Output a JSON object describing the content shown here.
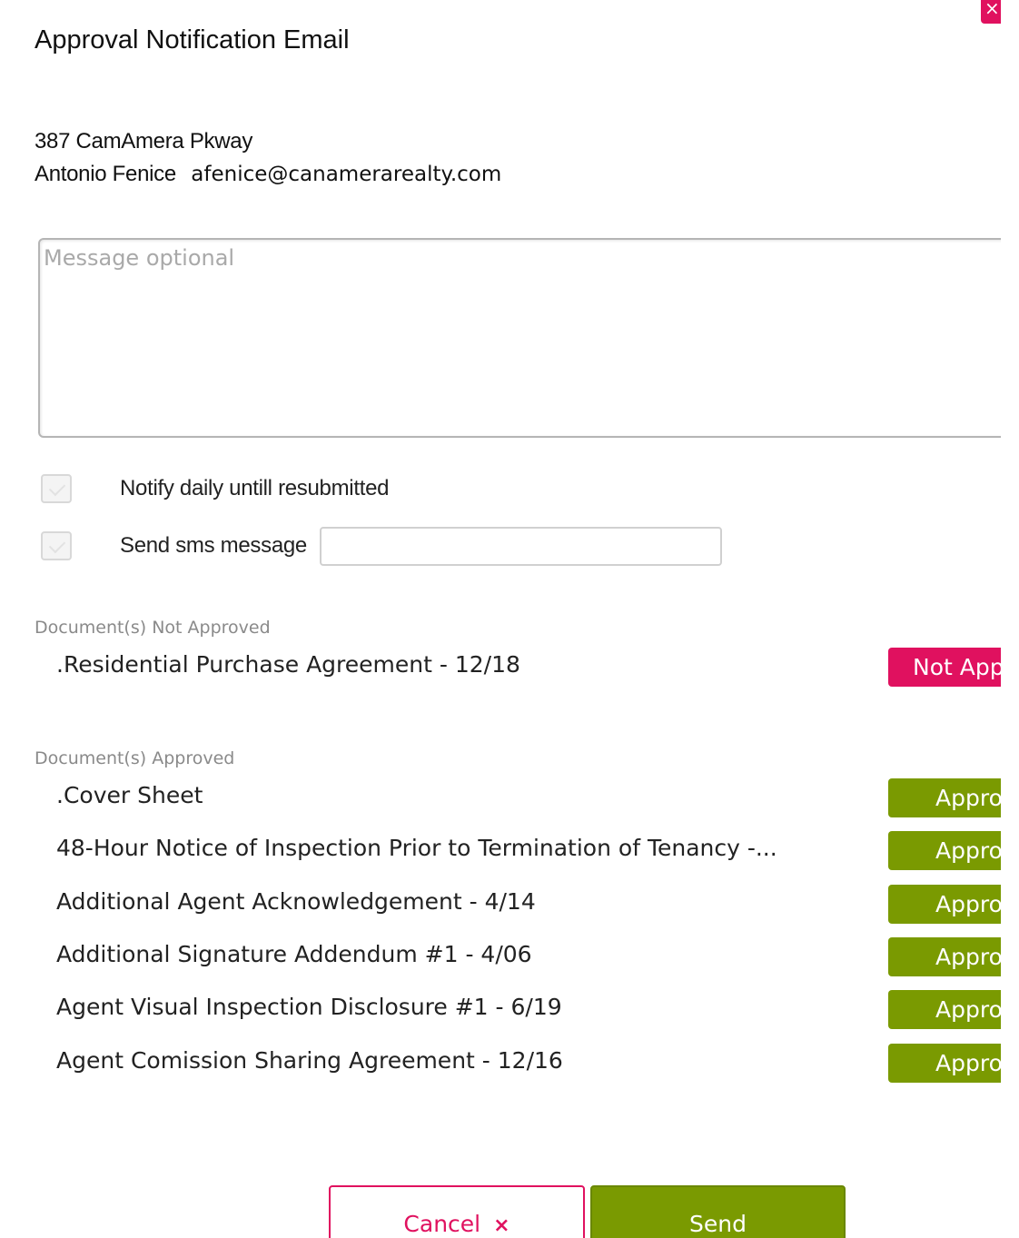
{
  "dialog": {
    "title": "Approval Notification Email",
    "close_icon": "×"
  },
  "recipient": {
    "address": "387 CamAmera Pkway",
    "name": "Antonio Fenice",
    "email": "afenice@canamerarealty.com"
  },
  "message": {
    "placeholder": "Message optional",
    "value": ""
  },
  "options": {
    "notify_daily_label": "Notify daily untill resubmitted",
    "notify_daily_checked": false,
    "sms_label": "Send sms message",
    "sms_checked": false,
    "sms_value": ""
  },
  "not_approved": {
    "label": "Document(s) Not Approved",
    "items": [
      {
        "name": ".Residential Purchase Agreement - 12/18",
        "status": "Not Approved"
      }
    ]
  },
  "approved": {
    "label": "Document(s) Approved",
    "items": [
      {
        "name": ".Cover Sheet",
        "status": "Approved"
      },
      {
        "name": "48-Hour Notice of Inspection Prior to Termination of Tenancy -...",
        "status": "Approved"
      },
      {
        "name": "Additional Agent Acknowledgement - 4/14",
        "status": "Approved"
      },
      {
        "name": "Additional Signature Addendum #1 - 4/06",
        "status": "Approved"
      },
      {
        "name": "Agent Visual Inspection Disclosure #1 - 6/19",
        "status": "Approved"
      },
      {
        "name": "Agent Comission Sharing Agreement - 12/16",
        "status": "Approved"
      }
    ]
  },
  "footer": {
    "cancel_label": "Cancel",
    "cancel_icon": "×",
    "send_label": "Send"
  },
  "colors": {
    "accent_pink": "#e0115f",
    "approved_green": "#7a9a01"
  },
  "icons": [
    "close-icon",
    "checkbox-check-icon",
    "cancel-x-icon"
  ]
}
